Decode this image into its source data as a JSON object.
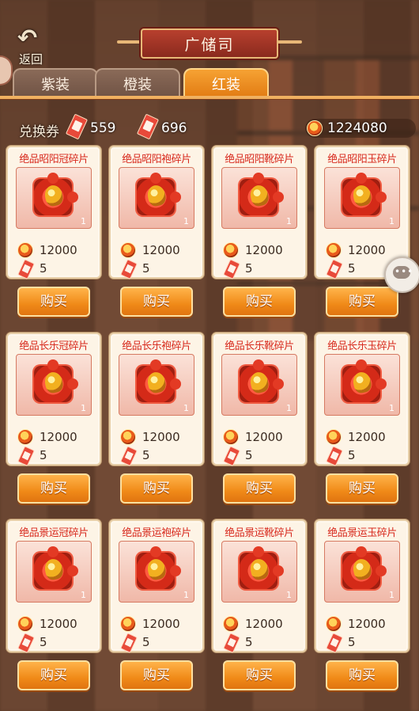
{
  "header": {
    "back_label": "返回",
    "title": "广储司"
  },
  "tabs": [
    {
      "label": "紫装",
      "active": false
    },
    {
      "label": "橙装",
      "active": false
    },
    {
      "label": "红装",
      "active": true
    }
  ],
  "currency": {
    "label": "兑换券",
    "ticket_count": "559",
    "second_ticket_count": "696",
    "coin_count": "1224080"
  },
  "items": [
    {
      "name": "绝品昭阳冠碎片",
      "qty": "1",
      "coin_price": "12000",
      "ticket_price": "5",
      "buy_label": "购买"
    },
    {
      "name": "绝品昭阳袍碎片",
      "qty": "1",
      "coin_price": "12000",
      "ticket_price": "5",
      "buy_label": "购买"
    },
    {
      "name": "绝品昭阳靴碎片",
      "qty": "1",
      "coin_price": "12000",
      "ticket_price": "5",
      "buy_label": "购买"
    },
    {
      "name": "绝品昭阳玉碎片",
      "qty": "1",
      "coin_price": "12000",
      "ticket_price": "5",
      "buy_label": "购买"
    },
    {
      "name": "绝品长乐冠碎片",
      "qty": "1",
      "coin_price": "12000",
      "ticket_price": "5",
      "buy_label": "购买"
    },
    {
      "name": "绝品长乐袍碎片",
      "qty": "1",
      "coin_price": "12000",
      "ticket_price": "5",
      "buy_label": "购买"
    },
    {
      "name": "绝品长乐靴碎片",
      "qty": "1",
      "coin_price": "12000",
      "ticket_price": "5",
      "buy_label": "购买"
    },
    {
      "name": "绝品长乐玉碎片",
      "qty": "1",
      "coin_price": "12000",
      "ticket_price": "5",
      "buy_label": "购买"
    },
    {
      "name": "绝品景运冠碎片",
      "qty": "1",
      "coin_price": "12000",
      "ticket_price": "5",
      "buy_label": "购买"
    },
    {
      "name": "绝品景运袍碎片",
      "qty": "1",
      "coin_price": "12000",
      "ticket_price": "5",
      "buy_label": "购买"
    },
    {
      "name": "绝品景运靴碎片",
      "qty": "1",
      "coin_price": "12000",
      "ticket_price": "5",
      "buy_label": "购买"
    },
    {
      "name": "绝品景运玉碎片",
      "qty": "1",
      "coin_price": "12000",
      "ticket_price": "5",
      "buy_label": "购买"
    }
  ],
  "colors": {
    "accent_orange": "#f08a18",
    "title_red": "#d82a1e",
    "card_bg": "#fdf4e6"
  }
}
